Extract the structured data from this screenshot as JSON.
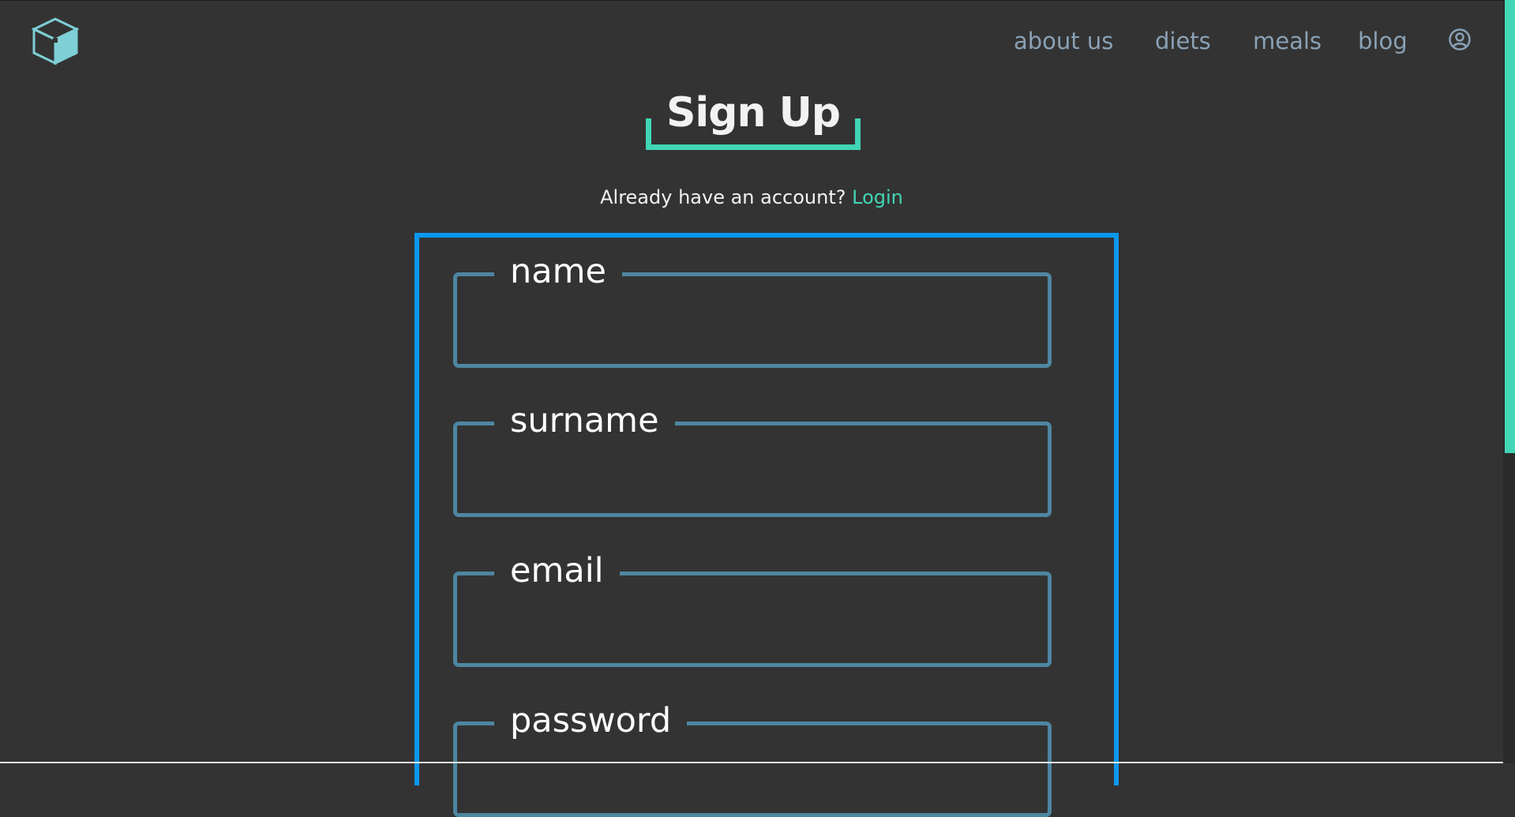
{
  "header": {
    "logo_icon": "cube-logo-icon",
    "nav": [
      {
        "label": "about us"
      },
      {
        "label": "diets"
      },
      {
        "label": "meals"
      },
      {
        "label": "blog"
      }
    ],
    "account_icon": "user-circle-icon"
  },
  "page": {
    "title": "Sign Up",
    "already_text": "Already have an account? ",
    "login_label": "Login"
  },
  "form": {
    "fields": [
      {
        "label": "name",
        "value": "",
        "placeholder": ""
      },
      {
        "label": "surname",
        "value": "",
        "placeholder": ""
      },
      {
        "label": "email",
        "value": "",
        "placeholder": ""
      },
      {
        "label": "password",
        "value": "",
        "placeholder": ""
      }
    ]
  },
  "colors": {
    "background": "#333333",
    "accent": "#41d6b6",
    "form_border": "#0b98f0",
    "field_border": "#4e86a1",
    "nav_text": "#8aa1b5",
    "text": "#f2f2f2"
  }
}
